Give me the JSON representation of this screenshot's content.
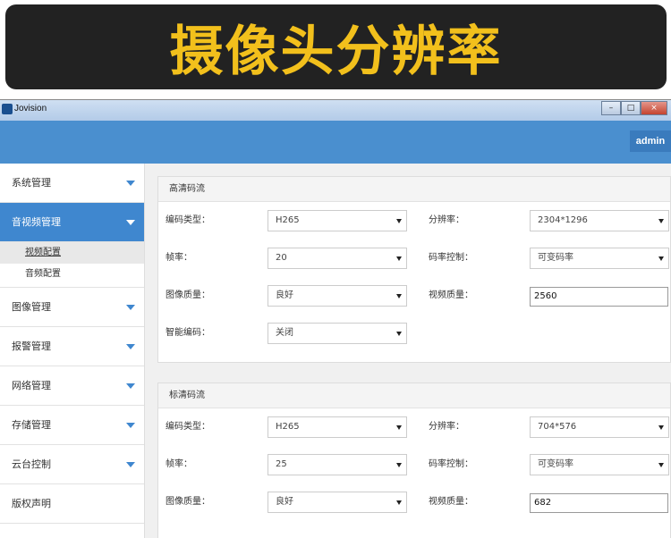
{
  "banner": {
    "title": "摄像头分辨率"
  },
  "window": {
    "app_title": "Jovision",
    "min": "–",
    "max": "□",
    "close": "×"
  },
  "header": {
    "user": "admin"
  },
  "sidebar": {
    "items": [
      {
        "label": "系统管理"
      },
      {
        "label": "音视频管理"
      },
      {
        "label": "图像管理"
      },
      {
        "label": "报警管理"
      },
      {
        "label": "网络管理"
      },
      {
        "label": "存储管理"
      },
      {
        "label": "云台控制"
      },
      {
        "label": "版权声明"
      }
    ],
    "subitems": [
      {
        "label": "视频配置"
      },
      {
        "label": "音频配置"
      }
    ]
  },
  "hd_stream": {
    "title": "高清码流",
    "codec_label": "编码类型：",
    "codec_value": "H265",
    "resolution_label": "分辨率：",
    "resolution_value": "2304*1296",
    "framerate_label": "帧率：",
    "framerate_value": "20",
    "bitrate_control_label": "码率控制：",
    "bitrate_control_value": "可变码率",
    "image_quality_label": "图像质量：",
    "image_quality_value": "良好",
    "video_quality_label": "视频质量：",
    "video_quality_value": "2560",
    "smart_codec_label": "智能编码：",
    "smart_codec_value": "关闭"
  },
  "sd_stream": {
    "title": "标清码流",
    "codec_label": "编码类型：",
    "codec_value": "H265",
    "resolution_label": "分辨率：",
    "resolution_value": "704*576",
    "framerate_label": "帧率：",
    "framerate_value": "25",
    "bitrate_control_label": "码率控制：",
    "bitrate_control_value": "可变码率",
    "image_quality_label": "图像质量：",
    "image_quality_value": "良好",
    "video_quality_label": "视频质量：",
    "video_quality_value": "682"
  }
}
